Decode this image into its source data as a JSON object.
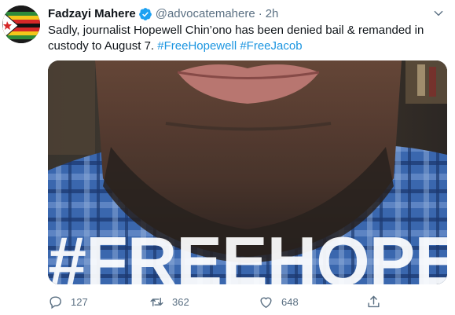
{
  "author": {
    "display_name": "Fadzayi Mahere",
    "handle": "@advocatemahere",
    "separator": "·",
    "timestamp": "2h",
    "verified": true,
    "avatar_icon": "zimbabwe-flag-avatar"
  },
  "tweet": {
    "text_plain": "Sadly, journalist Hopewell Chin’ono has been denied bail & remanded in custody to August 7.",
    "hashtags": [
      "#FreeHopewell",
      "#FreeJacob"
    ]
  },
  "media": {
    "overlay_text": "#FREEHOPE"
  },
  "actions": {
    "reply_count": "127",
    "retweet_count": "362",
    "like_count": "648",
    "reply_icon": "reply-icon",
    "retweet_icon": "retweet-icon",
    "like_icon": "heart-icon",
    "share_icon": "share-icon"
  },
  "colors": {
    "link": "#1b95e0",
    "verified": "#1da1f2",
    "secondary_text": "#5b7083",
    "primary_text": "#0f1419"
  }
}
